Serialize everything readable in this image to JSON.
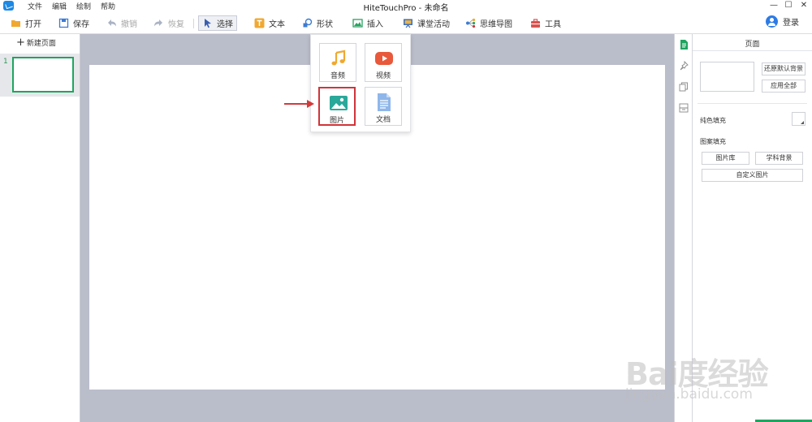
{
  "window": {
    "title": "HiteTouchPro - 未命名",
    "controls": {
      "minimize": "—",
      "maximize": "☐",
      "close": "✕"
    }
  },
  "menu": [
    "文件",
    "编辑",
    "绘制",
    "帮助"
  ],
  "toolbar": {
    "open": "打开",
    "save": "保存",
    "undo": "撤销",
    "redo": "恢复",
    "select": "选择",
    "text": "文本",
    "shape": "形状",
    "insert": "插入",
    "classroom": "课堂活动",
    "mindmap": "思维导图",
    "tools": "工具",
    "login": "登录"
  },
  "left_panel": {
    "new_page": "新建页面",
    "pages": [
      {
        "number": "1"
      }
    ]
  },
  "insert_popup": {
    "items": [
      {
        "label": "音频",
        "icon": "music-note-icon"
      },
      {
        "label": "视频",
        "icon": "video-play-icon"
      },
      {
        "label": "图片",
        "icon": "picture-icon",
        "selected": true
      },
      {
        "label": "文档",
        "icon": "document-icon"
      }
    ]
  },
  "right_panel": {
    "title": "页面",
    "restore_default_bg": "还原默认背景",
    "apply_all": "应用全部",
    "solid_fill": "纯色填充",
    "pattern_fill": "图案填充",
    "image_library": "图片库",
    "subject_bg": "学科背景",
    "custom_image": "自定义图片"
  },
  "watermark": {
    "brand": "Bai度经验",
    "url": "jingyan.baidu.com"
  },
  "colors": {
    "accent_green": "#1fa461",
    "highlight_red": "#d0343a",
    "canvas_bg": "#babdca"
  }
}
